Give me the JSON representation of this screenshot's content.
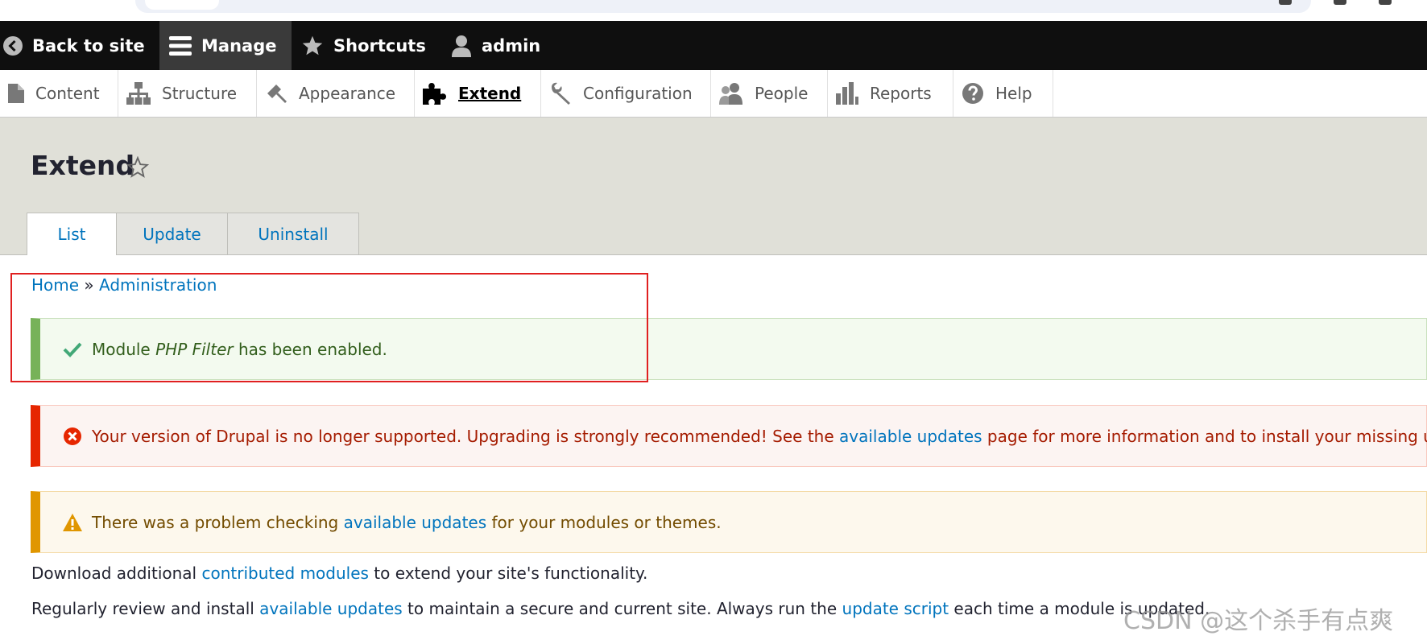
{
  "toolbar": {
    "back_label": "Back to site",
    "manage_label": "Manage",
    "shortcuts_label": "Shortcuts",
    "user_label": "admin"
  },
  "tray": {
    "items": [
      {
        "label": "Content",
        "icon": "file-icon"
      },
      {
        "label": "Structure",
        "icon": "sitemap-icon"
      },
      {
        "label": "Appearance",
        "icon": "paintbrush-icon"
      },
      {
        "label": "Extend",
        "icon": "puzzle-icon",
        "active": true
      },
      {
        "label": "Configuration",
        "icon": "wrench-icon"
      },
      {
        "label": "People",
        "icon": "people-icon"
      },
      {
        "label": "Reports",
        "icon": "bar-chart-icon"
      },
      {
        "label": "Help",
        "icon": "question-icon"
      }
    ]
  },
  "page": {
    "title": "Extend"
  },
  "tabs": [
    {
      "label": "List",
      "active": true
    },
    {
      "label": "Update"
    },
    {
      "label": "Uninstall"
    }
  ],
  "breadcrumb": {
    "home": "Home",
    "separator": "»",
    "administration": "Administration"
  },
  "messages": {
    "status": {
      "prefix": "Module ",
      "module": "PHP Filter",
      "suffix": " has been enabled."
    },
    "error": {
      "prefix": "Your version of Drupal is no longer supported. Upgrading is strongly recommended! See the ",
      "link": "available updates",
      "suffix": " page for more information and to install your missing updates."
    },
    "warning": {
      "prefix": "There was a problem checking ",
      "link": "available updates",
      "suffix": " for your modules or themes."
    }
  },
  "content": {
    "p1_prefix": "Download additional ",
    "p1_link": "contributed modules",
    "p1_suffix": " to extend your site's functionality.",
    "p2_prefix": "Regularly review and install ",
    "p2_link1": "available updates",
    "p2_mid": " to maintain a secure and current site. Always run the ",
    "p2_link2": "update script",
    "p2_suffix": " each time a module is updated."
  },
  "watermark": "CSDN @这个杀手有点爽",
  "colors": {
    "link": "#0074bd",
    "status_accent": "#77b259",
    "error_accent": "#e62600",
    "warning_accent": "#e09600",
    "highlight_box": "#e02020"
  }
}
